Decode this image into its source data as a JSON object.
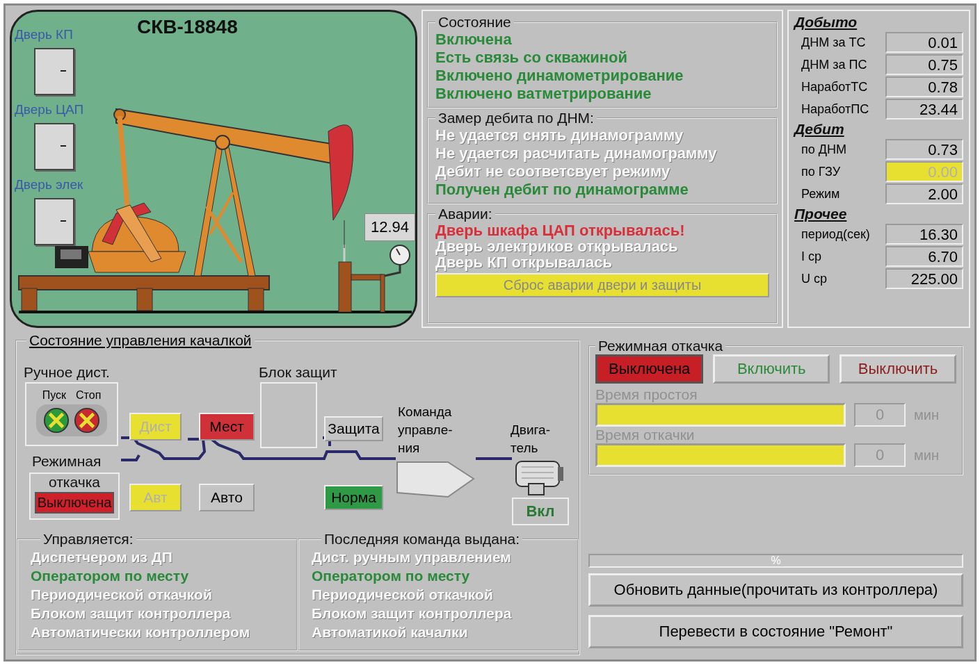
{
  "well": {
    "title": "СКВ-18848",
    "doors": [
      {
        "label": "Дверь КП"
      },
      {
        "label": "Дверь ЦАП"
      },
      {
        "label": "Дверь элек"
      }
    ],
    "reading": "12.94"
  },
  "state": {
    "title": "Состояние",
    "items": [
      {
        "text": "Включена",
        "active": true
      },
      {
        "text": "Есть связь со скважиной",
        "active": true
      },
      {
        "text": "Включено динамометрирование",
        "active": true
      },
      {
        "text": "Включено ватметрирование",
        "active": true
      }
    ]
  },
  "dnm": {
    "title": "Замер дебита по ДНМ:",
    "items": [
      {
        "text": "Не удается снять динамограмму",
        "active": false
      },
      {
        "text": "Не удается расчитать динамограмму",
        "active": false
      },
      {
        "text": "Дебит не соответсвует режиму",
        "active": false
      },
      {
        "text": "Получен дебит по динамограмме",
        "active": true
      }
    ]
  },
  "alarms": {
    "title": "Аварии:",
    "items": [
      {
        "text": "Дверь шкафа ЦАП открывалась!",
        "active": true
      },
      {
        "text": "Дверь электриков открывалась",
        "active": false
      },
      {
        "text": "Дверь КП открывалась",
        "active": false
      }
    ],
    "reset_button": "Сброс аварии двери и защиты"
  },
  "stats": [
    {
      "title": "Добыто",
      "rows": [
        {
          "label": "ДНМ за ТС",
          "value": "0.01",
          "highlighted": false
        },
        {
          "label": "ДНМ за ПС",
          "value": "0.75",
          "highlighted": false
        },
        {
          "label": "НаработТС",
          "value": "0.78",
          "highlighted": false
        },
        {
          "label": "НаработПС",
          "value": "23.44",
          "highlighted": false
        }
      ]
    },
    {
      "title": "Дебит",
      "rows": [
        {
          "label": "по ДНМ",
          "value": "0.73",
          "highlighted": false
        },
        {
          "label": "по ГЗУ",
          "value": "0.00",
          "highlighted": true
        },
        {
          "label": "Режим",
          "value": "2.00",
          "highlighted": false
        }
      ]
    },
    {
      "title": "Прочее",
      "rows": [
        {
          "label": "период(сек)",
          "value": "16.30",
          "highlighted": false
        },
        {
          "label": "I ср",
          "value": "6.70",
          "highlighted": false
        },
        {
          "label": "U ср",
          "value": "225.00",
          "highlighted": false
        }
      ]
    }
  ],
  "control": {
    "title": "Состояние управления качалкой",
    "manual": {
      "title": "Ручное дист.",
      "start": "Пуск",
      "stop": "Стоп"
    },
    "periodic": {
      "title": "Режимная",
      "subtitle": "откачка",
      "status": "Выключена"
    },
    "switches": [
      {
        "label": "Дист",
        "color": "#e8e030"
      },
      {
        "label": "Авт",
        "color": "#e8e030"
      },
      {
        "label": "Мест",
        "color": "#d03038"
      },
      {
        "label": "Авто",
        "color": "#c4c4c4"
      },
      {
        "label": "Защита",
        "color": "#c4c4c4"
      },
      {
        "label": "Норма",
        "color": "#2f9a45"
      }
    ],
    "protection_title": "Блок защит",
    "command_lines": [
      "Команда",
      "управле-",
      "ния"
    ],
    "motor_lines": [
      "Двига-",
      "тель"
    ],
    "motor_status": "Вкл"
  },
  "controlled_by": {
    "title": "Управляется:",
    "items": [
      {
        "text": "Диспетчером из ДП",
        "active": false
      },
      {
        "text": "Оператором по месту",
        "active": true
      },
      {
        "text": "Периодической откачкой",
        "active": false
      },
      {
        "text": "Блоком защит контроллера",
        "active": false
      },
      {
        "text": "Автоматически контроллером",
        "active": false
      }
    ]
  },
  "last_command": {
    "title": "Последняя команда выдана:",
    "items": [
      {
        "text": "Дист. ручным управлением",
        "active": false
      },
      {
        "text": "Оператором по месту",
        "active": true
      },
      {
        "text": "Периодической откачкой",
        "active": false
      },
      {
        "text": "Блоком защит контроллера",
        "active": false
      },
      {
        "text": "Автоматикой качалки",
        "active": false
      }
    ]
  },
  "periodic_pumping": {
    "title": "Режимная откачка",
    "status": "Выключена",
    "buttons": [
      {
        "label": "Включить",
        "kind": "on"
      },
      {
        "label": "Выключить",
        "kind": "off"
      }
    ],
    "timers": [
      {
        "label": "Время простоя",
        "value": "0",
        "unit": "мин",
        "disabled": true
      },
      {
        "label": "Время откачки",
        "value": "0",
        "unit": "мин",
        "disabled": true
      }
    ]
  },
  "progress": {
    "label": "%",
    "level": 0
  },
  "actions": [
    "Обновить данные(прочитать из контроллера)",
    "Перевести в состояние \"Ремонт\""
  ]
}
